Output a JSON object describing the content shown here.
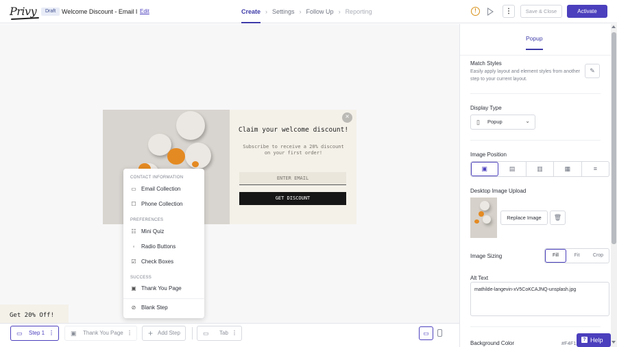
{
  "header": {
    "logo": "Privy",
    "status_badge": "Draft",
    "campaign_name": "Welcome Discount - Email I",
    "edit_link": "Edit",
    "steps": [
      {
        "label": "Create",
        "state": "active"
      },
      {
        "label": "Settings",
        "state": "normal"
      },
      {
        "label": "Follow Up",
        "state": "normal"
      },
      {
        "label": "Reporting",
        "state": "disabled"
      }
    ],
    "save_close_label": "Save & Close",
    "activate_label": "Activate",
    "warning_glyph": "!"
  },
  "popup": {
    "title": "Claim your welcome discount!",
    "subtitle": "Subscribe to receive a 20% discount on your first order!",
    "email_placeholder": "ENTER EMAIL",
    "cta_label": "GET DISCOUNT",
    "close_glyph": "×"
  },
  "add_step_menu": {
    "sections": [
      {
        "title": "CONTACT INFORMATION",
        "items": [
          {
            "label": "Email Collection",
            "icon": "inbox-icon"
          },
          {
            "label": "Phone Collection",
            "icon": "phone-icon"
          }
        ]
      },
      {
        "title": "PREFERENCES",
        "items": [
          {
            "label": "Mini Quiz",
            "icon": "quiz-icon"
          },
          {
            "label": "Radio Buttons",
            "icon": "radio-list-icon"
          },
          {
            "label": "Check Boxes",
            "icon": "checkbox-list-icon"
          }
        ]
      },
      {
        "title": "SUCCESS",
        "items": [
          {
            "label": "Thank You Page",
            "icon": "image-card-icon"
          }
        ]
      }
    ],
    "blank_step": {
      "label": "Blank Step",
      "icon": "no-icon"
    }
  },
  "teaser_text": "Get 20% Off!",
  "step_bar": {
    "steps": [
      {
        "label": "Step 1",
        "selected": true
      },
      {
        "label": "Thank You Page",
        "selected": false
      }
    ],
    "add_step_label": "Add Step",
    "tab_label": "Tab",
    "device": "desktop"
  },
  "panel": {
    "tab_label": "Popup",
    "match_styles": {
      "label": "Match Styles",
      "description": "Easily apply layout and element styles from another step to your current layout."
    },
    "display_type": {
      "label": "Display Type",
      "value": "Popup"
    },
    "image_position": {
      "label": "Image Position",
      "options": [
        "image-left-icon",
        "image-right-icon",
        "image-top-icon",
        "image-bottom-icon",
        "no-image-icon"
      ],
      "selected_index": 0
    },
    "desktop_image_upload": {
      "label": "Desktop Image Upload",
      "replace_label": "Replace Image"
    },
    "image_sizing": {
      "label": "Image Sizing",
      "options": [
        "Fill",
        "Fit",
        "Crop"
      ],
      "selected": "Fill"
    },
    "alt_text": {
      "label": "Alt Text",
      "value": "mathilde-langevin-xV5CoKCAJNQ-unsplash.jpg"
    },
    "background_color": {
      "label": "Background Color",
      "value": "#F4F1"
    }
  },
  "help_label": "Help",
  "colors": {
    "accent": "#4b3fbd",
    "popup_bg": "#f4f1e9",
    "cta_bg": "#161616",
    "warning": "#d89016"
  }
}
